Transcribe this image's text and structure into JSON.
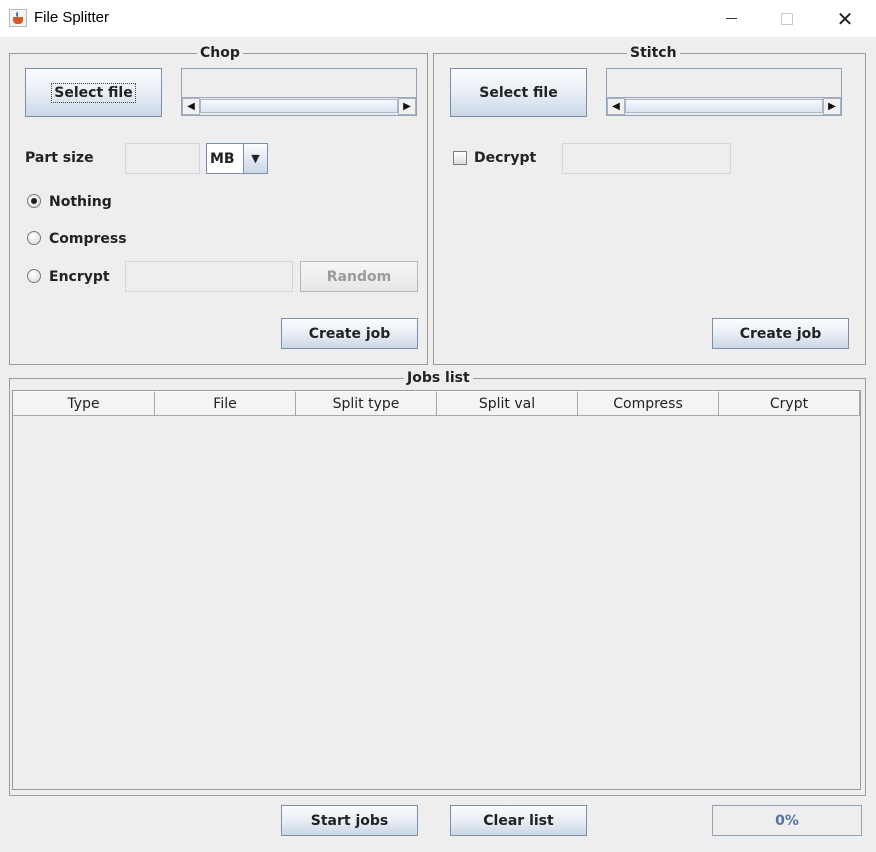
{
  "window": {
    "title": "File Splitter",
    "app_icon": "java-cup-icon",
    "minimize_icon": "minimize-icon",
    "maximize_icon": "maximize-icon",
    "close_icon": "close-icon",
    "close_glyph": "✕"
  },
  "chop": {
    "legend": "Chop",
    "select_file_label": "Select file",
    "file_path_value": "",
    "part_size_label": "Part size",
    "part_size_value": "",
    "unit_selected": "MB",
    "options": [
      {
        "label": "Nothing",
        "selected": true
      },
      {
        "label": "Compress",
        "selected": false
      },
      {
        "label": "Encrypt",
        "selected": false
      }
    ],
    "encrypt_key_value": "",
    "random_label": "Random",
    "create_job_label": "Create job"
  },
  "stitch": {
    "legend": "Stitch",
    "select_file_label": "Select file",
    "file_path_value": "",
    "decrypt_label": "Decrypt",
    "decrypt_checked": false,
    "decrypt_key_value": "",
    "create_job_label": "Create job"
  },
  "jobs": {
    "legend": "Jobs list",
    "columns": [
      "Type",
      "File",
      "Split type",
      "Split val",
      "Compress",
      "Crypt"
    ],
    "rows": []
  },
  "footer": {
    "start_jobs_label": "Start jobs",
    "clear_list_label": "Clear list",
    "progress_text": "0%",
    "progress_fraction": 0
  },
  "scroll_arrows": {
    "left": "◀",
    "right": "▶"
  },
  "combo_arrow": "▼"
}
